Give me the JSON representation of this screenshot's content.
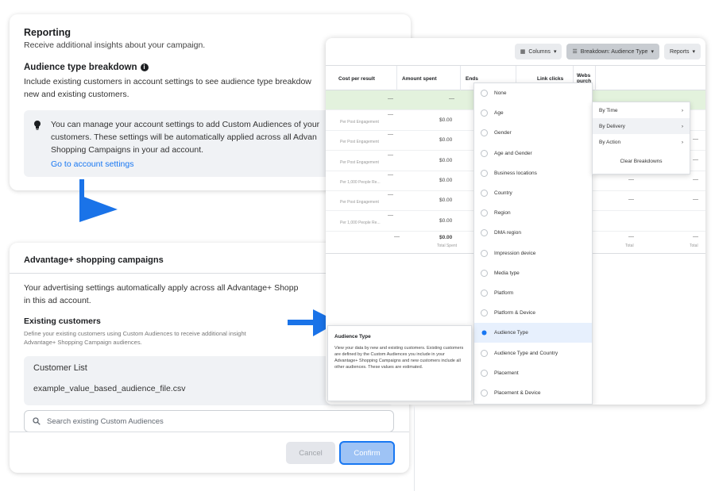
{
  "reporting": {
    "title": "Reporting",
    "subtitle": "Receive additional insights about your campaign.",
    "breakdown_heading": "Audience type breakdown",
    "body_line1": "Include existing customers in account settings to see audience type breakdow",
    "body_line2": "new and existing customers.",
    "note_line1": "You can manage your account settings to add Custom Audiences of your",
    "note_line2": "customers. These settings will be automatically applied across all Advan",
    "note_line3": "Shopping Campaigns in your ad account.",
    "link": "Go to account settings"
  },
  "advantage": {
    "title": "Advantage+ shopping campaigns",
    "body_line1": "Your advertising settings automatically apply across all Advantage+ Shopp",
    "body_line2": "in this ad account.",
    "existing_heading": "Existing customers",
    "small_line1": "Define your existing customers using Custom Audiences to receive additional insight",
    "small_line2": "Advantage+ Shopping Campaign audiences.",
    "customer_list_label": "Customer List",
    "customer_list_value": "example_value_based_audience_file.csv",
    "search_placeholder": "Search existing Custom Audiences",
    "cancel": "Cancel",
    "confirm": "Confirm"
  },
  "table": {
    "columns_btn": "Columns",
    "breakdown_btn": "Breakdown: Audience Type",
    "reports_btn": "Reports",
    "headers": [
      "Cost per result",
      "Amount spent",
      "Ends",
      "Link clicks",
      "Webs purch"
    ],
    "amounts": [
      "$0.00",
      "$0.00",
      "$0.00",
      "$0.00",
      "$0.00",
      "$0.00"
    ],
    "result_types": [
      "Per Post Engagement",
      "Per Post Engagement",
      "Per Post Engagement",
      "Per 1,000 People Re...",
      "Per Post Engagement",
      "Per 1,000 People Re..."
    ],
    "total_amount": "$0.00",
    "total_label": "Total Spent",
    "total_col_label": "Total",
    "dash": "—"
  },
  "dropdown": {
    "items": [
      "None",
      "Age",
      "Gender",
      "Age and Gender",
      "Business locations",
      "Country",
      "Region",
      "DMA region",
      "Impression device",
      "Media type",
      "Platform",
      "Platform & Device",
      "Audience Type",
      "Audience Type and Country",
      "Placement",
      "Placement & Device"
    ],
    "selected": "Audience Type"
  },
  "submenu": {
    "items": [
      "By Time",
      "By Delivery",
      "By Action"
    ],
    "clear": "Clear Breakdowns"
  },
  "tooltip": {
    "title": "Audience Type",
    "text": "View your data by new and existing customers. Existing customers are defined by the Custom Audiences you include in your Advantage+ Shopping Campaigns and new customers include all other audiences. These values are estimated."
  },
  "colors": {
    "accent": "#1877f2",
    "arrow": "#1a73e8",
    "selected_row": "#e3f2dd"
  }
}
